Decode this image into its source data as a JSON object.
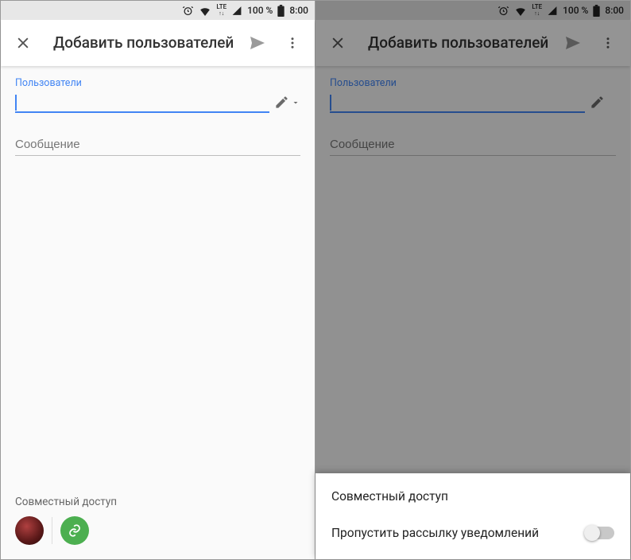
{
  "statusbar": {
    "lte": "LTE",
    "battery_pct": "100 %",
    "time": "8:00"
  },
  "appbar": {
    "title": "Добавить пользователей"
  },
  "fields": {
    "users_label": "Пользователи",
    "message_placeholder": "Сообщение"
  },
  "bottom": {
    "shared_access_label": "Совместный доступ"
  },
  "sheet": {
    "item1": "Совместный доступ",
    "item2": "Пропустить рассылку уведомлений"
  }
}
